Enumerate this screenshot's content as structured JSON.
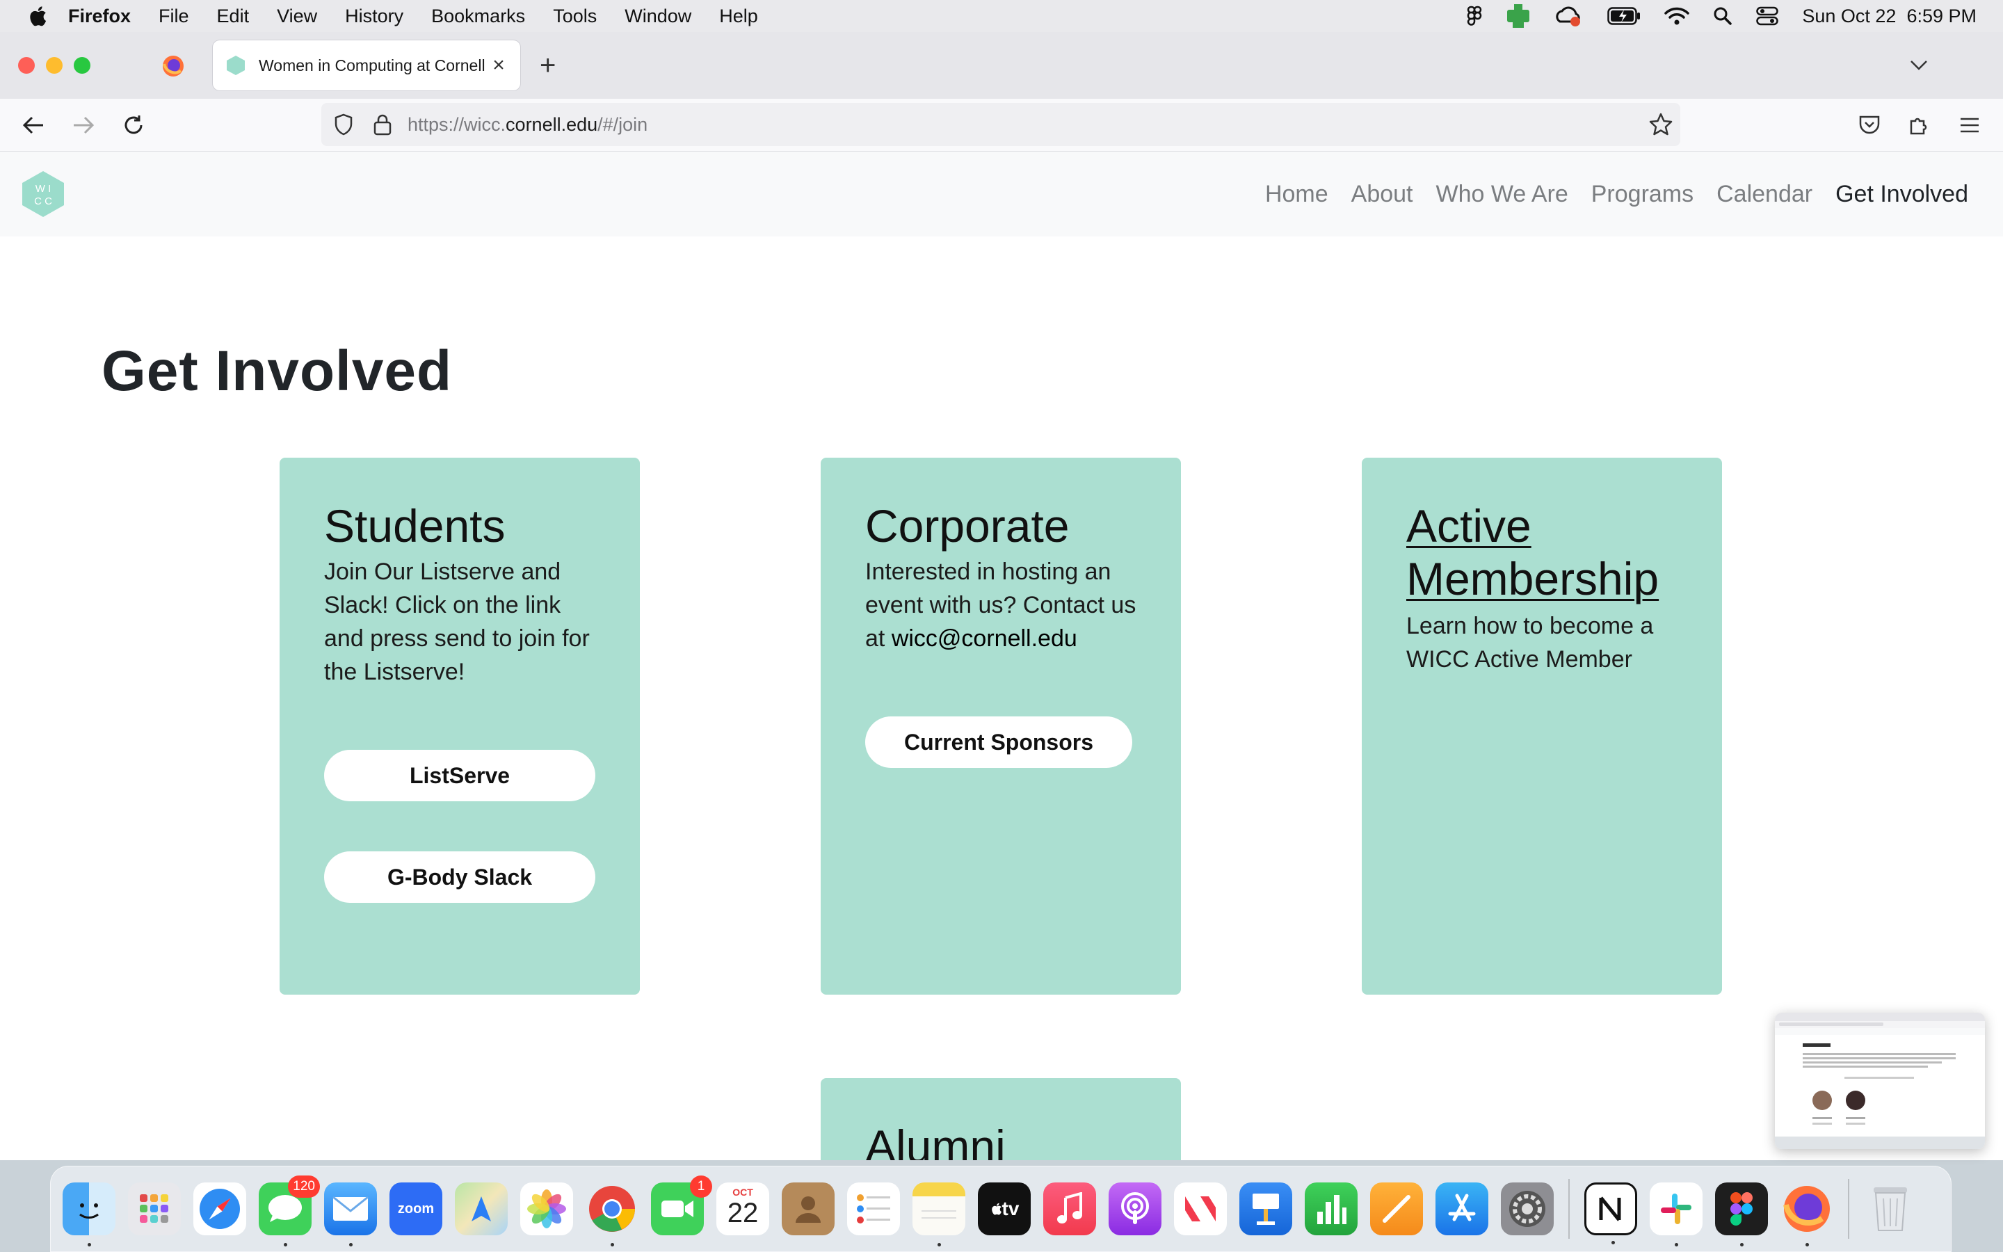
{
  "menubar": {
    "app_name": "Firefox",
    "menus": [
      "File",
      "Edit",
      "View",
      "History",
      "Bookmarks",
      "Tools",
      "Window",
      "Help"
    ],
    "clock": "Sun Oct 22  6:59 PM"
  },
  "browser": {
    "tab_title": "Women in Computing at Cornell",
    "url_prefix": "https://wicc.",
    "url_domain": "cornell.edu",
    "url_path": "/#/join"
  },
  "site": {
    "logo_text": "WICC",
    "nav": [
      "Home",
      "About",
      "Who We Are",
      "Programs",
      "Calendar",
      "Get Involved"
    ],
    "active_nav": "Get Involved",
    "page_title": "Get Involved"
  },
  "cards": {
    "students": {
      "title": "Students",
      "text": "Join Our Listserve and Slack! Click on the link and press send to join for the Listserve!",
      "btn1": "ListServe",
      "btn2": "G-Body Slack"
    },
    "corporate": {
      "title": "Corporate",
      "text_pre": "Interested in hosting an event with us? Contact us at ",
      "email": "wicc@cornell.edu",
      "btn": "Current Sponsors"
    },
    "membership": {
      "title": "Active Membership",
      "text": "Learn how to become a WICC Active Member"
    },
    "alumni": {
      "title": "Alumni"
    }
  },
  "dock": {
    "calendar_month": "OCT",
    "calendar_day": "22",
    "messages_badge": "120",
    "facetime_badge": "1",
    "zoom_label": "zoom",
    "tv_label": "tv"
  },
  "colors": {
    "card_bg": "#abdfd1",
    "logo": "#9bdccb"
  }
}
